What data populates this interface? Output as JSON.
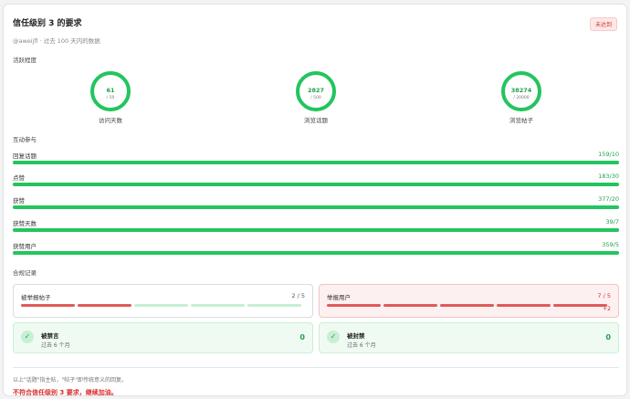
{
  "header": {
    "title": "信任级别 3 的要求",
    "status_badge": "未达到",
    "subtitle": "@aweijfl · 过去 100 天内的数据"
  },
  "activity": {
    "section_label": "活跃程度",
    "rings": [
      {
        "value": "61",
        "target": "/ 50",
        "label": "访问天数",
        "progress": 1.0
      },
      {
        "value": "2827",
        "target": "/ 500",
        "label": "浏览话题",
        "progress": 1.0
      },
      {
        "value": "38274",
        "target": "/ 20000",
        "label": "浏览帖子",
        "progress": 1.0
      }
    ]
  },
  "interaction": {
    "section_label": "互动参与",
    "bars": [
      {
        "label": "回复话题",
        "value": "159/10",
        "progress": 1.0
      },
      {
        "label": "点赞",
        "value": "183/30",
        "progress": 1.0
      },
      {
        "label": "获赞",
        "value": "377/20",
        "progress": 1.0
      },
      {
        "label": "获赞天数",
        "value": "39/7",
        "progress": 1.0
      },
      {
        "label": "获赞用户",
        "value": "359/5",
        "progress": 1.0
      }
    ]
  },
  "compliance": {
    "section_label": "合规记录",
    "reported_posts": {
      "label": "被举报帖子",
      "count": "2 / 5",
      "filled": 2,
      "total": 5
    },
    "reporting_users": {
      "label": "举报用户",
      "count": "7 / 5",
      "filled": 5,
      "total": 5,
      "extra": "+2"
    },
    "silenced": {
      "title": "被禁言",
      "sub": "过去 6 个月",
      "value": "0",
      "icon": "check-icon"
    },
    "suspended": {
      "title": "被封禁",
      "sub": "过去 6 个月",
      "value": "0",
      "icon": "check-icon"
    }
  },
  "footer": {
    "note": "以上\"话题\"指主帖，\"帖子\"即传统意义的回复。",
    "result": "不符合信任级别 3 要求，继续加油。"
  },
  "colors": {
    "accent_green": "#22c55e",
    "accent_red": "#d92d2d"
  }
}
